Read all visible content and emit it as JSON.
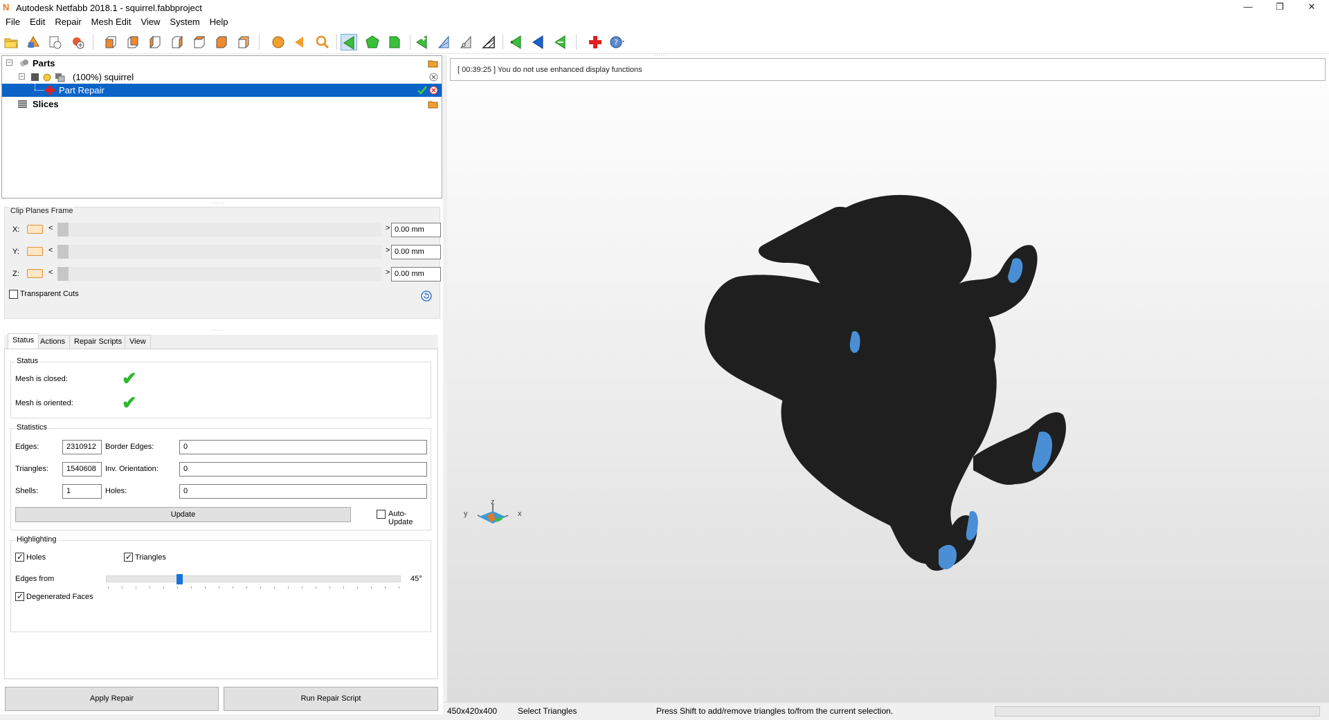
{
  "window": {
    "title": "Autodesk Netfabb 2018.1 - squirrel.fabbproject",
    "minimize": "—",
    "maximize": "❐",
    "close": "✕"
  },
  "menu": [
    "File",
    "Edit",
    "Repair",
    "Mesh Edit",
    "View",
    "System",
    "Help"
  ],
  "tree": {
    "parts_label": "Parts",
    "part_label": "(100%) squirrel",
    "repair_label": "Part Repair",
    "slices_label": "Slices"
  },
  "clip_planes": {
    "title": "Clip Planes Frame",
    "x_label": "X:",
    "y_label": "Y:",
    "z_label": "Z:",
    "x_value": "0.00 mm",
    "y_value": "0.00 mm",
    "z_value": "0.00 mm",
    "lt": "<",
    "gt": ">",
    "transparent_cuts": "Transparent Cuts"
  },
  "tabs": [
    "Status",
    "Actions",
    "Repair Scripts",
    "View"
  ],
  "status": {
    "group_title": "Status",
    "mesh_closed": "Mesh is closed:",
    "mesh_oriented": "Mesh is oriented:",
    "check": "✔"
  },
  "statistics": {
    "group_title": "Statistics",
    "edges_label": "Edges:",
    "edges_value": "2310912",
    "border_edges_label": "Border Edges:",
    "border_edges_value": "0",
    "triangles_label": "Triangles:",
    "triangles_value": "1540608",
    "inv_orientation_label": "Inv. Orientation:",
    "inv_orientation_value": "0",
    "shells_label": "Shells:",
    "shells_value": "1",
    "holes_label": "Holes:",
    "holes_value": "0",
    "update_button": "Update",
    "auto_update": "Auto-Update"
  },
  "highlighting": {
    "group_title": "Highlighting",
    "holes": "Holes",
    "triangles": "Triangles",
    "edges_from": "Edges from",
    "edges_value": "45°",
    "degenerated_faces": "Degenerated Faces"
  },
  "buttons": {
    "apply_repair": "Apply Repair",
    "run_repair_script": "Run Repair Script"
  },
  "log": "[ 00:39:25 ] You do not use enhanced display functions",
  "axes": {
    "x": "x",
    "y": "y",
    "z": "z"
  },
  "statusbar": {
    "dimensions": "450x420x400",
    "mode": "Select Triangles",
    "hint": "Press Shift to add/remove triangles to/from the current selection."
  },
  "colors": {
    "selection": "#0a64c8",
    "model": "#1f1f1f",
    "model_highlight": "#4a8fd6",
    "check": "#2eb82e",
    "accent_orange": "#e8751a"
  }
}
